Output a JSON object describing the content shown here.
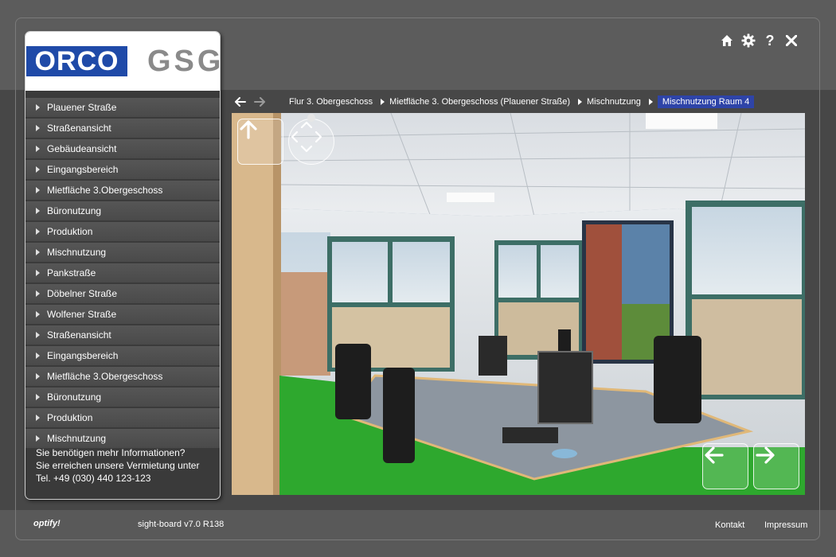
{
  "logos": {
    "orco": "ORCO",
    "gsg": "GSG"
  },
  "top_icons": [
    "home-icon",
    "gear-icon",
    "help-icon",
    "close-icon"
  ],
  "help_glyph": "?",
  "menu": [
    "Plauener Straße",
    "Straßenansicht",
    "Gebäudeansicht",
    "Eingangsbereich",
    "Mietfläche 3.Obergeschoss",
    "Büronutzung",
    "Produktion",
    "Mischnutzung",
    "Pankstraße",
    "Döbelner Straße",
    "Wolfener Straße",
    "Straßenansicht",
    "Eingangsbereich",
    "Mietfläche 3.Obergeschoss",
    "Büronutzung",
    "Produktion",
    "Mischnutzung"
  ],
  "info": {
    "line1": "Sie benötigen mehr Informationen?",
    "line2": "Sie erreichen unsere Vermietung unter",
    "line3": "Tel. +49 (030) 440 123-123"
  },
  "breadcrumbs": [
    "Flur 3. Obergeschoss",
    "Mietfläche 3. Obergeschoss (Plauener Straße)",
    "Mischnutzung",
    "Mischnutzung Raum 4"
  ],
  "footer": {
    "brand": "optify!",
    "version": "sight-board v7.0 R138",
    "contact": "Kontakt",
    "imprint": "Impressum"
  },
  "colors": {
    "accent": "#2e44a8",
    "orco_blue": "#1f4aa8",
    "floor": "#2ea82e"
  }
}
